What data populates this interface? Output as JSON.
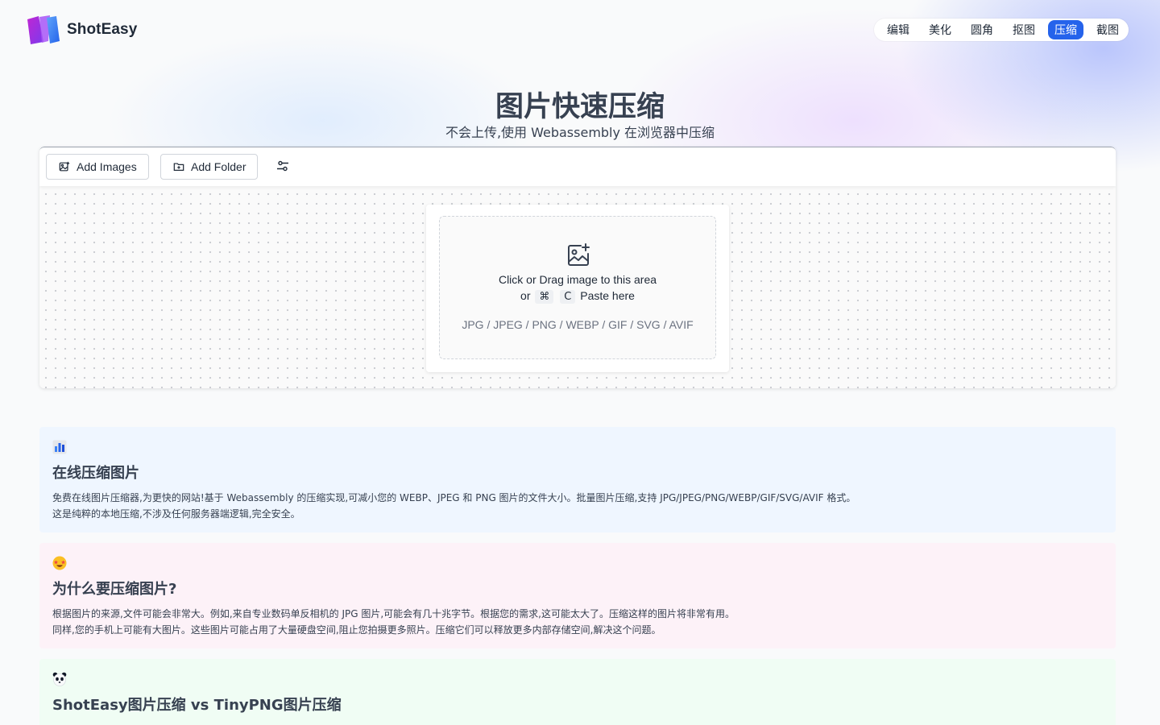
{
  "app": {
    "name": "ShotEasy"
  },
  "nav": {
    "items": [
      {
        "label": "编辑",
        "active": false
      },
      {
        "label": "美化",
        "active": false
      },
      {
        "label": "圆角",
        "active": false
      },
      {
        "label": "抠图",
        "active": false
      },
      {
        "label": "压缩",
        "active": true
      },
      {
        "label": "截图",
        "active": false
      }
    ]
  },
  "hero": {
    "title": "图片快速压缩",
    "subtitle": "不会上传,使用 Webassembly 在浏览器中压缩"
  },
  "toolbar": {
    "add_images": "Add Images",
    "add_folder": "Add Folder",
    "settings_icon": "sliders-icon"
  },
  "dropzone": {
    "line1": "Click or Drag image to this area",
    "line2_prefix": "or",
    "key_cmd": "⌘",
    "key_c": "C",
    "line2_suffix": "Paste here",
    "formats": "JPG / JPEG / PNG / WEBP / GIF / SVG / AVIF"
  },
  "sections": [
    {
      "emoji": "chart-emoji",
      "title": "在线压缩图片",
      "lines": [
        "免费在线图片压缩器,为更快的网站!基于 Webassembly 的压缩实现,可减小您的 WEBP、JPEG 和 PNG 图片的文件大小。批量图片压缩,支持 JPG/JPEG/PNG/WEBP/GIF/SVG/AVIF 格式。",
        "这是纯粹的本地压缩,不涉及任何服务器端逻辑,完全安全。"
      ]
    },
    {
      "emoji": "star-struck-emoji",
      "title": "为什么要压缩图片?",
      "lines": [
        "根据图片的来源,文件可能会非常大。例如,来自专业数码单反相机的 JPG 图片,可能会有几十兆字节。根据您的需求,这可能太大了。压缩这样的图片将非常有用。",
        "同样,您的手机上可能有大图片。这些图片可能占用了大量硬盘空间,阻止您拍摄更多照片。压缩它们可以释放更多内部存储空间,解决这个问题。"
      ]
    },
    {
      "emoji": "panda-emoji",
      "title": "ShotEasy图片压缩 vs TinyPNG图片压缩",
      "lines": []
    }
  ]
}
